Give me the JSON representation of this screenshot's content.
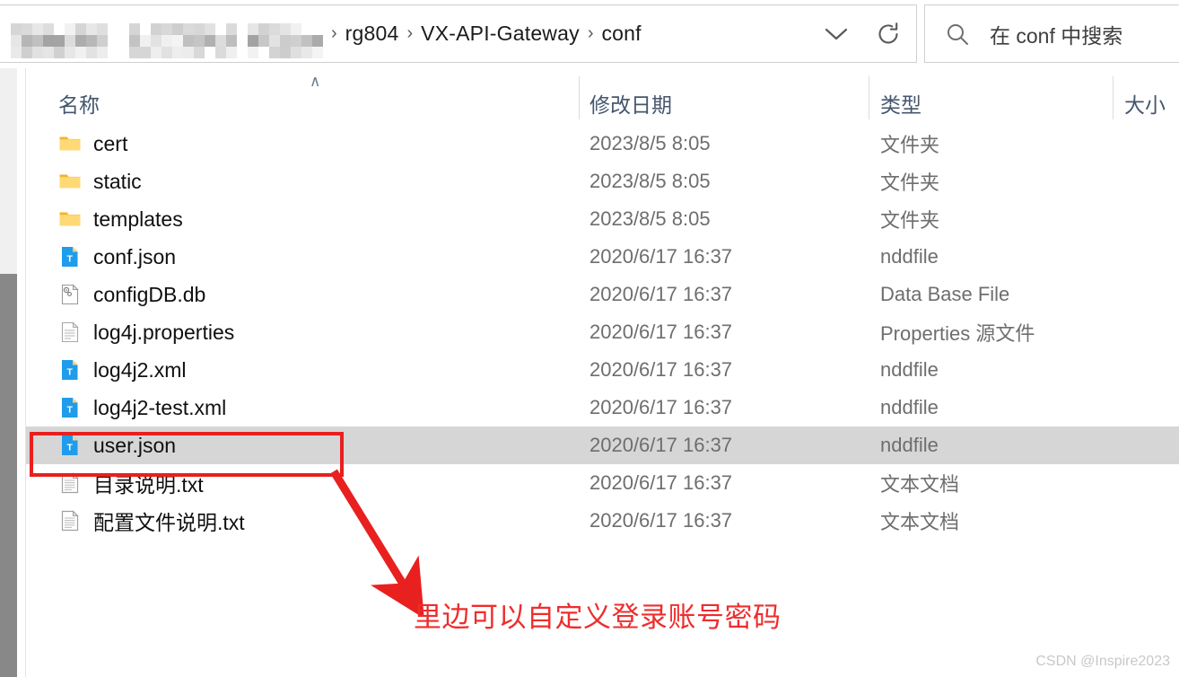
{
  "window": {
    "address_bar": {
      "censored_prefix": "blurred-path",
      "crumbs": [
        "rg804",
        "VX-API-Gateway",
        "conf"
      ],
      "separator": "›",
      "dropdown_icon": "chevron-down-icon",
      "refresh_icon": "refresh-icon"
    },
    "search": {
      "icon": "search-icon",
      "placeholder": "在 conf 中搜索"
    }
  },
  "columns": {
    "name": "名称",
    "date_modified": "修改日期",
    "type": "类型",
    "size": "大小",
    "sort_caret": "∧"
  },
  "files": [
    {
      "name": "cert",
      "date": "2023/8/5 8:05",
      "type": "文件夹",
      "icon": "folder-icon",
      "selected": false
    },
    {
      "name": "static",
      "date": "2023/8/5 8:05",
      "type": "文件夹",
      "icon": "folder-icon",
      "selected": false
    },
    {
      "name": "templates",
      "date": "2023/8/5 8:05",
      "type": "文件夹",
      "icon": "folder-icon",
      "selected": false
    },
    {
      "name": "conf.json",
      "date": "2020/6/17 16:37",
      "type": "nddfile",
      "icon": "blue-t-file-icon",
      "selected": false
    },
    {
      "name": "configDB.db",
      "date": "2020/6/17 16:37",
      "type": "Data Base File",
      "icon": "gear-file-icon",
      "selected": false
    },
    {
      "name": "log4j.properties",
      "date": "2020/6/17 16:37",
      "type": "Properties 源文件",
      "icon": "lined-file-icon",
      "selected": false
    },
    {
      "name": "log4j2.xml",
      "date": "2020/6/17 16:37",
      "type": "nddfile",
      "icon": "blue-t-file-icon",
      "selected": false
    },
    {
      "name": "log4j2-test.xml",
      "date": "2020/6/17 16:37",
      "type": "nddfile",
      "icon": "blue-t-file-icon",
      "selected": false
    },
    {
      "name": "user.json",
      "date": "2020/6/17 16:37",
      "type": "nddfile",
      "icon": "blue-t-file-icon",
      "selected": true
    },
    {
      "name": "目录说明.txt",
      "date": "2020/6/17 16:37",
      "type": "文本文档",
      "icon": "text-file-icon",
      "selected": false
    },
    {
      "name": "配置文件说明.txt",
      "date": "2020/6/17 16:37",
      "type": "文本文档",
      "icon": "text-file-icon",
      "selected": false
    }
  ],
  "annotation": {
    "text": "里边可以自定义登录账号密码",
    "color": "#ef2d2d",
    "highlight_target": "user.json"
  },
  "watermark": "CSDN @Inspire2023"
}
